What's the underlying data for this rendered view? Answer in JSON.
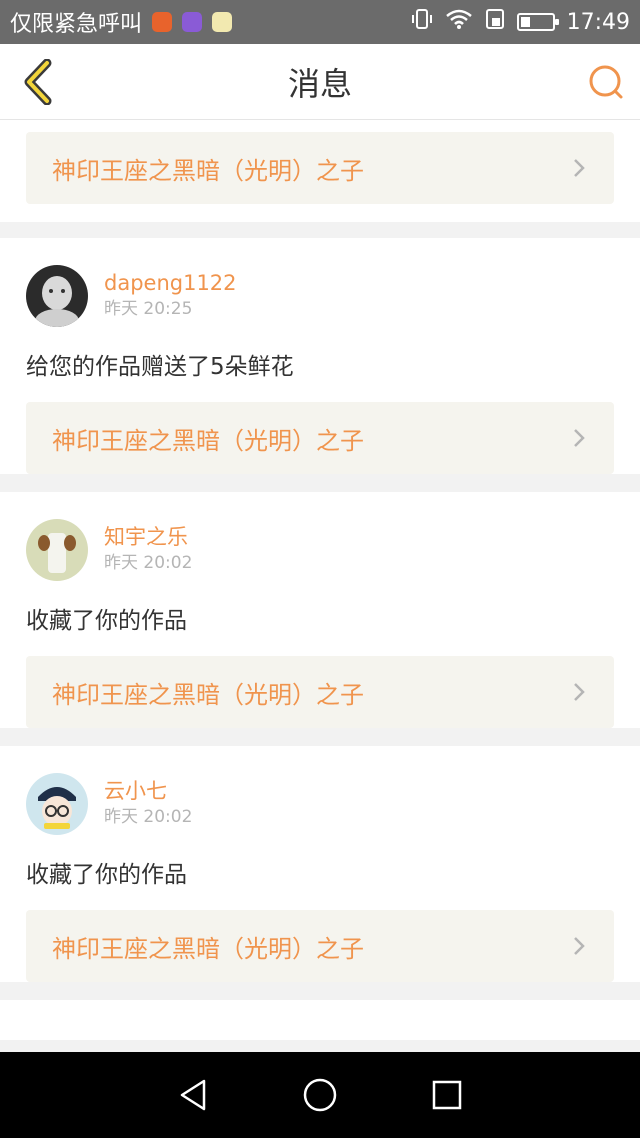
{
  "status_bar": {
    "carrier_text": "仅限紧急呼叫",
    "time": "17:49",
    "battery_percent": 30
  },
  "header": {
    "title": "消息"
  },
  "messages": [
    {
      "work_title": "神印王座之黑暗（光明）之子"
    },
    {
      "username": "dapeng1122",
      "time": "昨天 20:25",
      "text": "给您的作品赠送了5朵鲜花",
      "work_title": "神印王座之黑暗（光明）之子"
    },
    {
      "username": "知宇之乐",
      "time": "昨天 20:02",
      "text": "收藏了你的作品",
      "work_title": "神印王座之黑暗（光明）之子"
    },
    {
      "username": "云小七",
      "time": "昨天 20:02",
      "text": "收藏了你的作品",
      "work_title": "神印王座之黑暗（光明）之子"
    }
  ],
  "colors": {
    "accent": "#f0944d",
    "card_link_bg": "#f5f4ee",
    "status_bar_bg": "#6b6b6b"
  },
  "icons": {
    "back": "back-arrow-icon",
    "search": "search-icon",
    "chevron": "chevron-right-icon",
    "nav_back": "triangle-back-icon",
    "nav_home": "circle-home-icon",
    "nav_recent": "square-recent-icon"
  }
}
